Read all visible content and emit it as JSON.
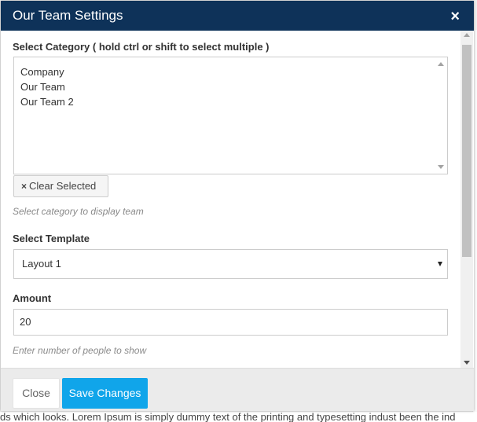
{
  "modal": {
    "title": "Our Team Settings",
    "close_glyph": "×"
  },
  "category": {
    "label": "Select Category ( hold ctrl or shift to select multiple )",
    "options": [
      "Company",
      "Our Team",
      "Our Team 2"
    ],
    "clear_icon": "×",
    "clear_label": "Clear Selected",
    "help": "Select category to display team"
  },
  "template": {
    "label": "Select Template",
    "value": "Layout 1"
  },
  "amount": {
    "label": "Amount",
    "value": "20",
    "help": "Enter number of people to show"
  },
  "footer": {
    "close_label": "Close",
    "save_label": "Save Changes"
  },
  "background": {
    "text": "ds which looks. Lorem Ipsum is simply dummy text of the printing and typesetting indust been the ind"
  },
  "colors": {
    "header_bg": "#0e3259",
    "save_button_bg": "#10a5ea"
  },
  "icons": {
    "close": "close-icon",
    "clear": "x-icon",
    "dropdown": "caret-down-icon"
  }
}
